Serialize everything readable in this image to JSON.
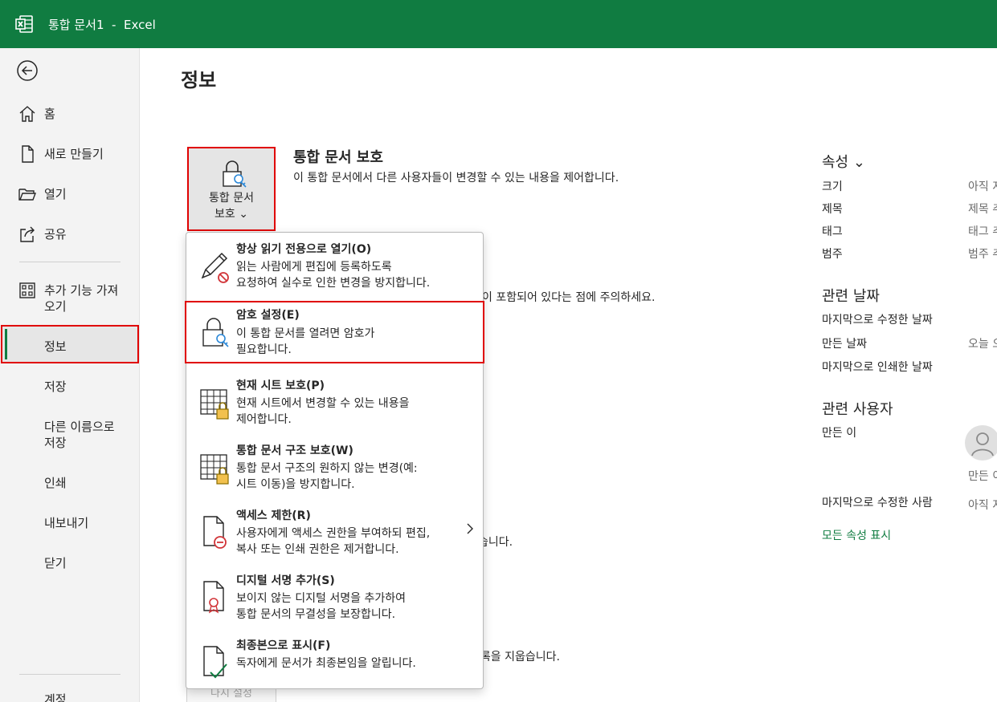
{
  "window": {
    "title": "통합 문서1  -  Excel",
    "app_icon": "excel-icon"
  },
  "sidebar": {
    "items": [
      {
        "label": "홈",
        "icon": "home-icon"
      },
      {
        "label": "새로 만들기",
        "icon": "new-document-icon"
      },
      {
        "label": "열기",
        "icon": "open-folder-icon"
      },
      {
        "label": "공유",
        "icon": "share-icon"
      },
      {
        "label": "추가 기능 가져\n오기",
        "icon": "add-ins-icon"
      },
      {
        "label": "정보"
      },
      {
        "label": "저장"
      },
      {
        "label": "다른 이름으로\n저장"
      },
      {
        "label": "인쇄"
      },
      {
        "label": "내보내기"
      },
      {
        "label": "닫기"
      },
      {
        "label": "계정"
      }
    ],
    "selected": "정보"
  },
  "main": {
    "title": "정보",
    "protect": {
      "button_label": "통합 문서\n보호 ⌄",
      "section_title": "통합 문서 보호",
      "section_desc": "이 통합 문서에서 다른 사용자들이 변경할 수 있는 내용을 제어합니다."
    },
    "obscured_text": [
      "이 포함되어 있다는 점에 주의하세요.",
      "습니다.",
      "기록을 지웁습니다."
    ],
    "disabled_button_label": "다시 설정"
  },
  "properties": {
    "header": "속성 ⌄",
    "rows": [
      {
        "k": "크기",
        "v": "아직 저"
      },
      {
        "k": "제목",
        "v": "제목 추"
      },
      {
        "k": "태그",
        "v": "태그 추"
      },
      {
        "k": "범주",
        "v": "범주 추"
      }
    ],
    "dates_header": "관련 날짜",
    "dates": [
      {
        "k": "마지막으로 수정한 날짜",
        "v": ""
      },
      {
        "k": "만든 날짜",
        "v": "오늘 오"
      },
      {
        "k": "마지막으로 인쇄한 날짜",
        "v": ""
      }
    ],
    "people_header": "관련 사용자",
    "people": [
      {
        "k": "만든 이",
        "v": "만든 이"
      },
      {
        "k": "마지막으로 수정한 사람",
        "v": "아직 저"
      }
    ],
    "show_all": "모든 속성 표시"
  },
  "menu": {
    "items": [
      {
        "title": "항상 읽기 전용으로 열기(O)",
        "desc": "읽는 사람에게 편집에 등록하도록\n요청하여 실수로 인한 변경을 방지합니다.",
        "icon": "pencil-no-edit-icon"
      },
      {
        "title": "암호 설정(E)",
        "desc": "이 통합 문서를 열려면 암호가\n필요합니다.",
        "icon": "lock-key-icon"
      },
      {
        "title": "현재 시트 보호(P)",
        "desc": "현재 시트에서 변경할 수 있는 내용을\n제어합니다.",
        "icon": "sheet-lock-icon"
      },
      {
        "title": "통합 문서 구조 보호(W)",
        "desc": "통합 문서 구조의 원하지 않는 변경(예:\n시트 이동)을 방지합니다.",
        "icon": "workbook-structure-lock-icon"
      },
      {
        "title": "액세스 제한(R)",
        "desc": "사용자에게 액세스 권한을 부여하되 편집,\n복사 또는 인쇄 권한은 제거합니다.",
        "icon": "restrict-access-icon"
      },
      {
        "title": "디지털 서명 추가(S)",
        "desc": "보이지 않는 디지털 서명을 추가하여\n통합 문서의 무결성을 보장합니다.",
        "icon": "digital-signature-icon"
      },
      {
        "title": "최종본으로 표시(F)",
        "desc": "독자에게 문서가 최종본임을 알립니다.",
        "icon": "mark-final-icon"
      }
    ],
    "highlighted": "암호 설정(E)"
  }
}
